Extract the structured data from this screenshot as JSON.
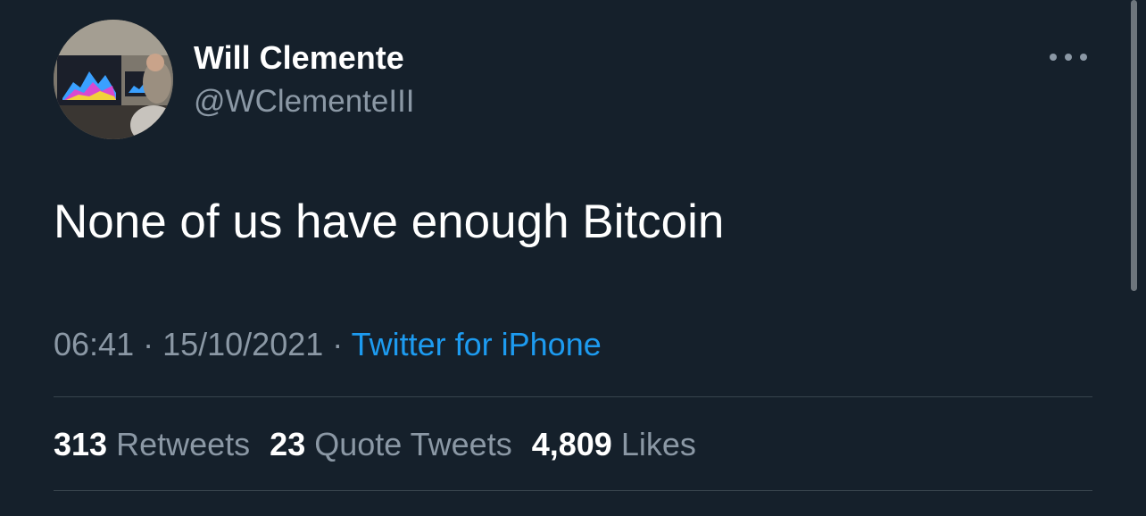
{
  "tweet": {
    "author_name": "Will Clemente",
    "author_handle": "@WClementeIII",
    "text": "None of us have enough Bitcoin",
    "time": "06:41",
    "separator": " · ",
    "date": "15/10/2021",
    "source": "Twitter for iPhone"
  },
  "stats": {
    "retweets_count": "313",
    "retweets_label": "Retweets",
    "quotes_count": "23",
    "quotes_label": "Quote Tweets",
    "likes_count": "4,809",
    "likes_label": "Likes"
  },
  "icons": {
    "more": "more-options-icon"
  },
  "colors": {
    "background": "#15202b",
    "primary_text": "#ffffff",
    "secondary_text": "#8b98a5",
    "link": "#1d9bf0",
    "divider": "#38444d"
  }
}
